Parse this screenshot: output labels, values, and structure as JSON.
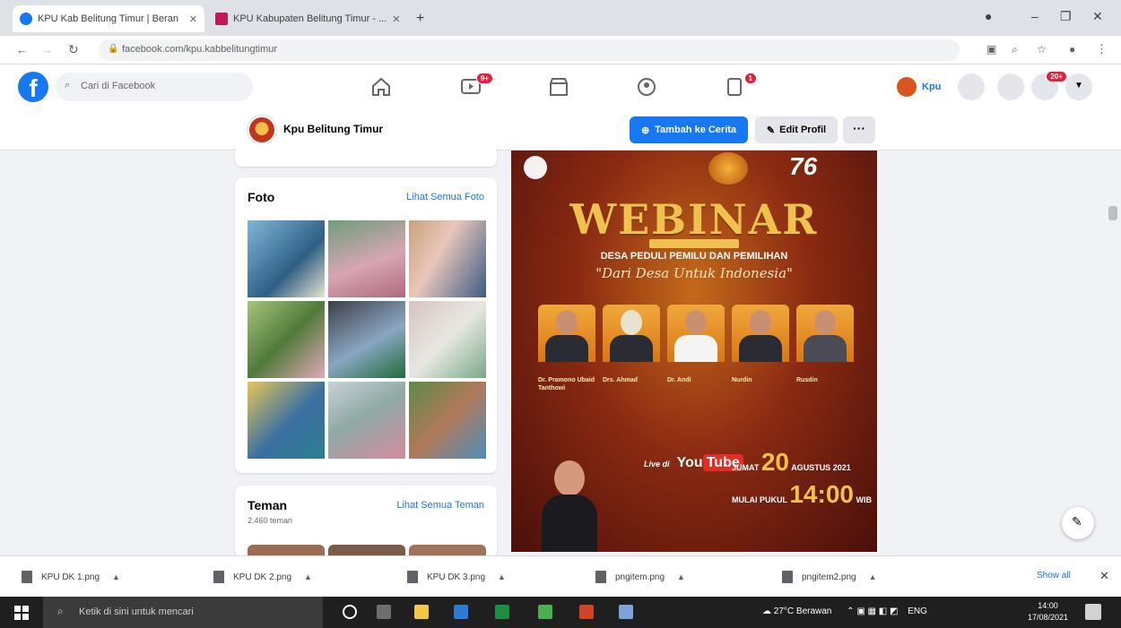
{
  "browser": {
    "tabs": [
      {
        "label": "KPU Kab Belitung Timur | Beran",
        "active": true
      },
      {
        "label": "KPU Kabupaten Belitung Timur - ...",
        "active": false
      }
    ],
    "new_tab": "+",
    "url": "facebook.com/kpu.kabbelitungtimur"
  },
  "facebook": {
    "search_placeholder": "Cari di Facebook",
    "badges": {
      "watch": "9+",
      "groups": "1",
      "notifications": "20+"
    },
    "profile_chip": "Kpu"
  },
  "profile_bar": {
    "page_name": "Kpu Belitung Timur",
    "follow_label": "Tambah ke Cerita",
    "edit_label": "Edit Profil",
    "more_label": "···"
  },
  "photos_card": {
    "title": "Foto",
    "see_all": "Lihat Semua Foto"
  },
  "friends_card": {
    "title": "Teman",
    "see_all": "Lihat Semua Teman",
    "count": "2.460 teman"
  },
  "post": {
    "title": "WEBINAR",
    "subtitle": "DESA PEDULI PEMILU DAN PEMILIHAN",
    "tagline": "\"Dari Desa Untuk Indonesia\"",
    "speakers": [
      "Dr. Pramono Ubaid Tanthowi",
      "Drs. Ahmad",
      "Dr. Andi",
      "Nurdin",
      "Rusdin"
    ],
    "youtube_pre": "Live di",
    "youtube_you": "You",
    "youtube_tube": "Tube",
    "date_label": "JUMAT",
    "date_day": "20",
    "date_rest": "AGUSTUS 2021",
    "time_label": "MULAI PUKUL",
    "time_value": "14:00",
    "time_unit": "WIB",
    "anniversary": "76"
  },
  "downloads": {
    "items": [
      "KPU DK 1.png",
      "KPU DK 2.png",
      "KPU DK 3.png",
      "pngitem.png",
      "pngitem2.png"
    ],
    "show_all": "Show all",
    "close": "✕"
  },
  "taskbar": {
    "search_placeholder": "Ketik di sini untuk mencari",
    "weather": "27°C Berawan",
    "lang": "ENG",
    "time": "14:00",
    "date": "17/08/2021"
  },
  "colors": {
    "fb_blue": "#1877f2",
    "badge_red": "#e41e3f",
    "gold": "#f1c14f"
  }
}
